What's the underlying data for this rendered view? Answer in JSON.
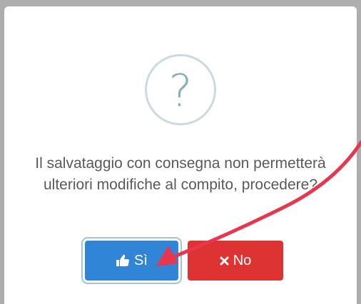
{
  "dialog": {
    "icon": "question-mark-icon",
    "icon_glyph": "?",
    "message": "Il salvataggio con consegna non permetterà ulteriori modifiche al compito, procedere?",
    "confirm_label": "Sì",
    "confirm_icon": "thumbs-up-icon",
    "cancel_label": "No",
    "cancel_icon": "times-icon"
  },
  "colors": {
    "confirm": "#3085d6",
    "cancel": "#dd3333",
    "icon": "#87adbd",
    "annotation_arrow": "#e8364f"
  }
}
